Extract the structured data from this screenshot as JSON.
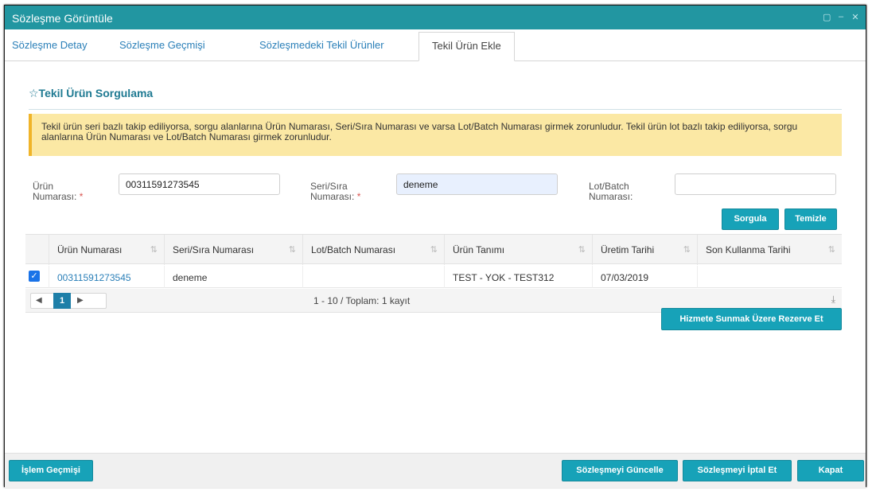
{
  "window": {
    "title": "Sözleşme Görüntüle"
  },
  "tabs": [
    {
      "label": "Sözleşme Detay"
    },
    {
      "label": "Sözleşme Geçmişi"
    },
    {
      "label": "Sözleşmedeki Tekil Ürünler"
    },
    {
      "label": "Tekil Ürün Ekle",
      "active": true
    }
  ],
  "section": {
    "title": "☆Tekil Ürün Sorgulama"
  },
  "alert": {
    "text": "Tekil ürün seri bazlı takip ediliyorsa, sorgu alanlarına Ürün Numarası, Seri/Sıra Numarası ve varsa Lot/Batch Numarası girmek zorunludur. Tekil ürün lot bazlı takip ediliyorsa, sorgu alanlarına Ürün Numarası ve Lot/Batch Numarası girmek zorunludur."
  },
  "form": {
    "urun": {
      "label1": "Ürün",
      "label2": "Numarası:",
      "required": "*",
      "value": "00311591273545"
    },
    "seri": {
      "label1": "Seri/Sıra",
      "label2": "Numarası:",
      "required": "*",
      "value": "deneme"
    },
    "lot": {
      "label1": "Lot/Batch",
      "label2": "Numarası:",
      "value": ""
    }
  },
  "buttons": {
    "sorgula": "Sorgula",
    "temizle": "Temizle",
    "rezerve": "Hizmete Sunmak Üzere Rezerve Et"
  },
  "grid": {
    "columns": [
      "Ürün Numarası",
      "Seri/Sıra Numarası",
      "Lot/Batch Numarası",
      "Ürün Tanımı",
      "Üretim Tarihi",
      "Son Kullanma Tarihi"
    ],
    "sort_icon": "sort-icon",
    "rows": [
      {
        "checked": true,
        "urun_no": "00311591273545",
        "seri": "deneme",
        "lot": "",
        "tanim": "TEST - YOK - TEST312",
        "uretim": "07/03/2019",
        "skt": ""
      }
    ],
    "pager": {
      "page": "1",
      "info": "1 - 10 / Toplam: 1 kayıt"
    }
  },
  "footer": {
    "islem": "İşlem Geçmişi",
    "guncelle": "Sözleşmeyi Güncelle",
    "iptal": "Sözleşmeyi İptal Et",
    "kapat": "Kapat"
  },
  "colors": {
    "accent": "#2296a1",
    "button": "#17a2b8",
    "alert_bg": "#fbe8a4",
    "link": "#2a7fb8"
  }
}
